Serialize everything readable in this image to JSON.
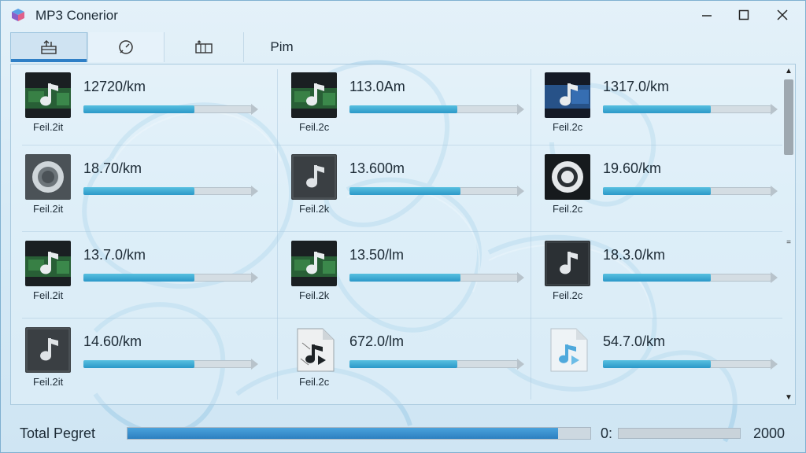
{
  "window": {
    "title": "MP3 Conerior",
    "controls": {
      "minimize": "—",
      "maximize": "☐",
      "close": "✕"
    }
  },
  "tabs": [
    {
      "label": "",
      "icon": "convert-icon",
      "active": true
    },
    {
      "label": "",
      "icon": "timer-icon",
      "active": false
    },
    {
      "label": "",
      "icon": "folder-bar-icon",
      "active": false
    },
    {
      "label": "Pim",
      "icon": "",
      "active": false
    }
  ],
  "files": [
    {
      "size": "12720/km",
      "label": "Feil.2it",
      "progress": 0.66,
      "thumb": "music-green"
    },
    {
      "size": "113.0Am",
      "label": "Feil.2c",
      "progress": 0.64,
      "thumb": "music-green"
    },
    {
      "size": "1317.0/km",
      "label": "Feil.2c",
      "progress": 0.64,
      "thumb": "music-blue"
    },
    {
      "size": "18.70/km",
      "label": "Feil.2it",
      "progress": 0.66,
      "thumb": "disc-gray"
    },
    {
      "size": "13.600m",
      "label": "Feil.2k",
      "progress": 0.66,
      "thumb": "music-gray"
    },
    {
      "size": "19.60/km",
      "label": "Feil.2c",
      "progress": 0.64,
      "thumb": "disc-dark"
    },
    {
      "size": "13.7.0/km",
      "label": "Feil.2it",
      "progress": 0.66,
      "thumb": "music-green"
    },
    {
      "size": "13.50/lm",
      "label": "Feil.2k",
      "progress": 0.66,
      "thumb": "music-green"
    },
    {
      "size": "18.3.0/km",
      "label": "Feil.2c",
      "progress": 0.64,
      "thumb": "music-dark"
    },
    {
      "size": "14.60/km",
      "label": "Feil.2it",
      "progress": 0.66,
      "thumb": "music-gray"
    },
    {
      "size": "672.0/lm",
      "label": "Feil.2c",
      "progress": 0.64,
      "thumb": "doc-music"
    },
    {
      "size": "54.7.0/km",
      "label": "",
      "progress": 0.64,
      "thumb": "doc-music-faded"
    }
  ],
  "scrollbar": {
    "up": "▲",
    "down": "▼",
    "marker": "="
  },
  "footer": {
    "label": "Total Pegret",
    "progress": 0.93,
    "mid_label": "0:",
    "total": "2000"
  },
  "colors": {
    "accent": "#2f7fc6",
    "progress": "#2b98c8",
    "total_progress": "#2c7fc0"
  }
}
